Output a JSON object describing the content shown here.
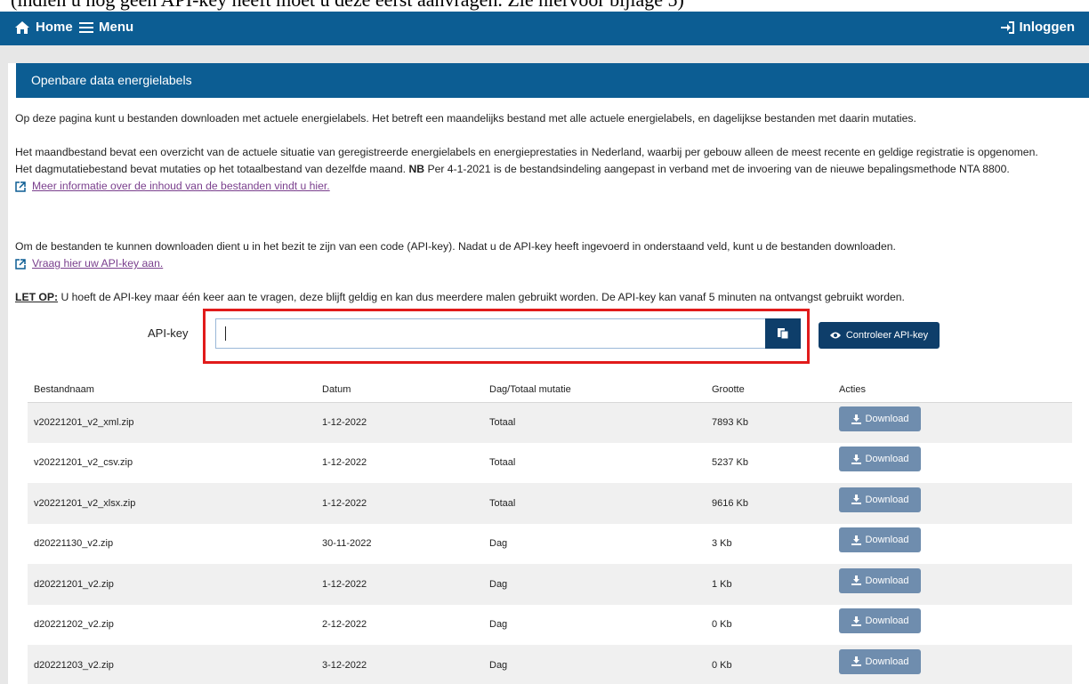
{
  "doc_caption": "(indien u nog geen API-key heeft moet u deze eerst aanvragen. Zie hiervoor bijlage 5)",
  "topbar": {
    "home_label": "Home",
    "menu_label": "Menu",
    "login_label": "Inloggen",
    "home_icon": "home-icon",
    "menu_icon": "hamburger-icon",
    "login_icon": "sign-in-icon",
    "color": "#0c5d93"
  },
  "panel": {
    "title": "Openbare data energielabels"
  },
  "intro": {
    "p1": "Op deze pagina kunt u bestanden downloaden met actuele energielabels. Het betreft een maandelijks bestand met alle actuele energielabels, en dagelijkse bestanden met daarin mutaties.",
    "p2_a": "Het maandbestand bevat een overzicht van de actuele situatie van geregistreerde energielabels en energieprestaties in Nederland, waarbij per gebouw alleen de meest recente en geldige registratie is opgenomen. Het dagmutatiebestand bevat mutaties op het totaalbestand van dezelfde maand.",
    "p2_nb": "NB",
    "p2_b": "Per 4-1-2021 is de bestandsindeling aangepast in verband met de invoering van de nieuwe bepalingsmethode NTA 8800.",
    "info_link": "Meer informatie over de inhoud van de bestanden vindt u hier.",
    "p3": "Om de bestanden te kunnen downloaden dient u in het bezit te zijn van een code (API-key). Nadat u de API-key heeft ingevoerd in onderstaand veld, kunt u de bestanden downloaden.",
    "apikey_link": "Vraag hier uw API-key aan.",
    "letop_label": "LET OP:",
    "letop_text": "U hoeft de API-key maar één keer aan te vragen, deze blijft geldig en kan dus meerdere malen gebruikt worden. De API-key kan vanaf 5 minuten na ontvangst gebruikt worden."
  },
  "api": {
    "label": "API-key",
    "value": "",
    "check_label": "Controleer API-key",
    "highlight_color": "#e11b1b"
  },
  "table": {
    "headers": [
      "Bestandnaam",
      "Datum",
      "Dag/Totaal mutatie",
      "Grootte",
      "Acties"
    ],
    "download_label": "Download",
    "rows": [
      {
        "name": "v20221201_v2_xml.zip",
        "date": "1-12-2022",
        "type": "Totaal",
        "size": "7893 Kb"
      },
      {
        "name": "v20221201_v2_csv.zip",
        "date": "1-12-2022",
        "type": "Totaal",
        "size": "5237 Kb"
      },
      {
        "name": "v20221201_v2_xlsx.zip",
        "date": "1-12-2022",
        "type": "Totaal",
        "size": "9616 Kb"
      },
      {
        "name": "d20221130_v2.zip",
        "date": "30-11-2022",
        "type": "Dag",
        "size": "3 Kb"
      },
      {
        "name": "d20221201_v2.zip",
        "date": "1-12-2022",
        "type": "Dag",
        "size": "1 Kb"
      },
      {
        "name": "d20221202_v2.zip",
        "date": "2-12-2022",
        "type": "Dag",
        "size": "0 Kb"
      },
      {
        "name": "d20221203_v2.zip",
        "date": "3-12-2022",
        "type": "Dag",
        "size": "0 Kb"
      }
    ]
  }
}
